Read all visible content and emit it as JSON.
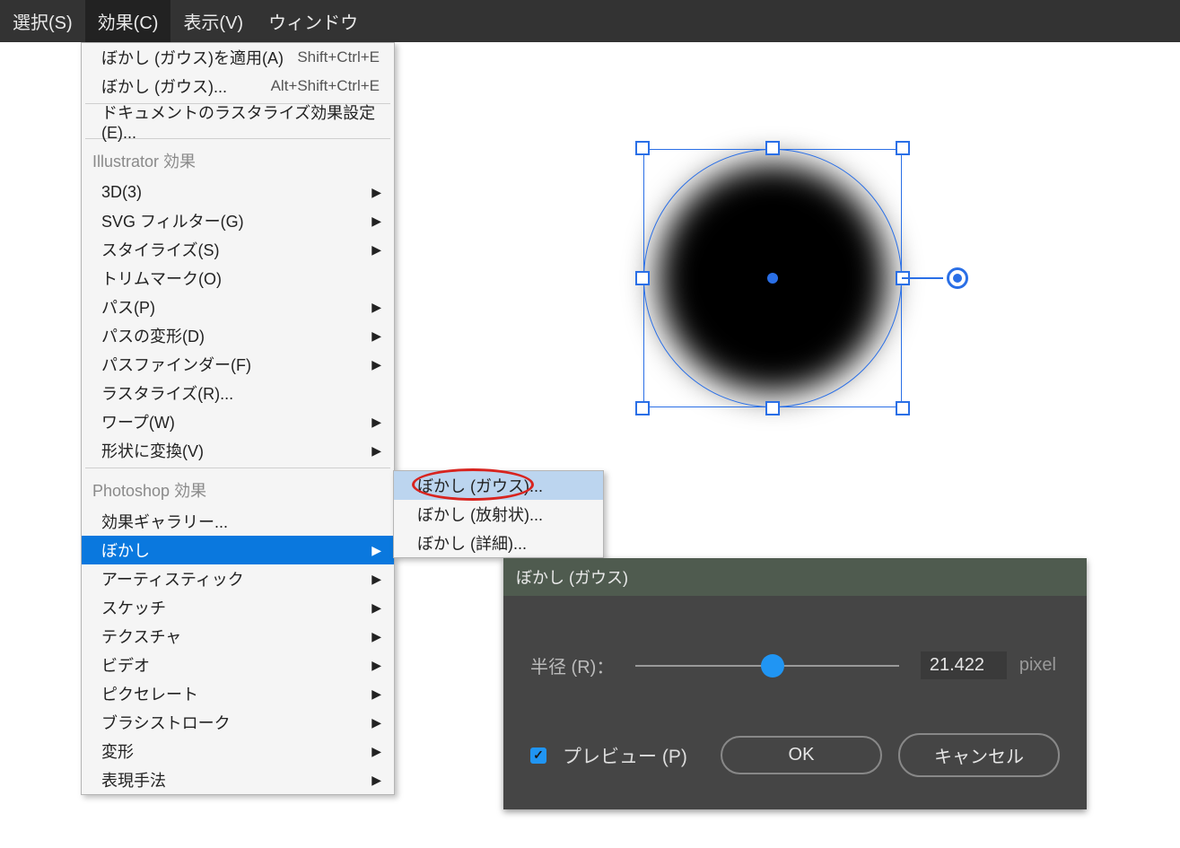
{
  "menubar": {
    "items": [
      {
        "label": "選択(S)"
      },
      {
        "label": "効果(C)"
      },
      {
        "label": "表示(V)"
      },
      {
        "label": "ウィンドウ"
      }
    ]
  },
  "menu": {
    "apply_last": {
      "label": "ぼかし (ガウス)を適用(A)",
      "shortcut": "Shift+Ctrl+E"
    },
    "last_effect": {
      "label": "ぼかし (ガウス)...",
      "shortcut": "Alt+Shift+Ctrl+E"
    },
    "doc_raster": {
      "label": "ドキュメントのラスタライズ効果設定(E)..."
    },
    "section_illustrator": "Illustrator 効果",
    "illustrator": [
      "3D(3)",
      "SVG フィルター(G)",
      "スタイライズ(S)",
      "トリムマーク(O)",
      "パス(P)",
      "パスの変形(D)",
      "パスファインダー(F)",
      "ラスタライズ(R)...",
      "ワープ(W)",
      "形状に変換(V)"
    ],
    "section_photoshop": "Photoshop 効果",
    "gallery": "効果ギャラリー...",
    "photoshop": [
      "ぼかし",
      "アーティスティック",
      "スケッチ",
      "テクスチャ",
      "ビデオ",
      "ピクセレート",
      "ブラシストローク",
      "変形",
      "表現手法"
    ]
  },
  "submenu": {
    "items": [
      "ぼかし (ガウス)...",
      "ぼかし (放射状)...",
      "ぼかし (詳細)..."
    ]
  },
  "dialog": {
    "title": "ぼかし (ガウス)",
    "radius_label": "半径 (R)：",
    "radius_value": "21.422",
    "radius_unit": "pixel",
    "preview_label": "プレビュー (P)",
    "ok": "OK",
    "cancel": "キャンセル"
  }
}
